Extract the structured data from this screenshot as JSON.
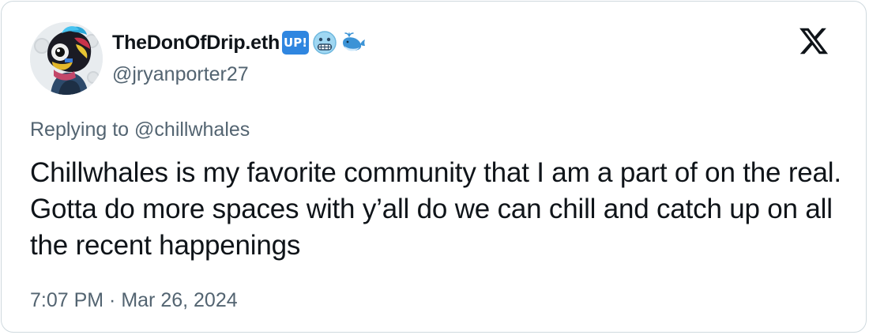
{
  "author": {
    "display_name": "TheDonOfDrip.eth",
    "badge_up_text": "UP!",
    "emoji_icons": [
      "grimacing-face-icon",
      "whale-icon"
    ],
    "handle": "@jryanporter27"
  },
  "reply": {
    "prefix": "Replying to ",
    "to_handle": "@chillwhales"
  },
  "tweet": {
    "text": "Chillwhales is my favorite community that I am a part of on the real. Gotta do more spaces with y’all do we can chill and catch up on all the recent happenings",
    "timestamp": "7:07 PM · Mar 26, 2024"
  },
  "colors": {
    "text_primary": "#0f1419",
    "text_secondary": "#536471",
    "border": "#cfd9de",
    "badge_blue": "#2f86e0"
  }
}
